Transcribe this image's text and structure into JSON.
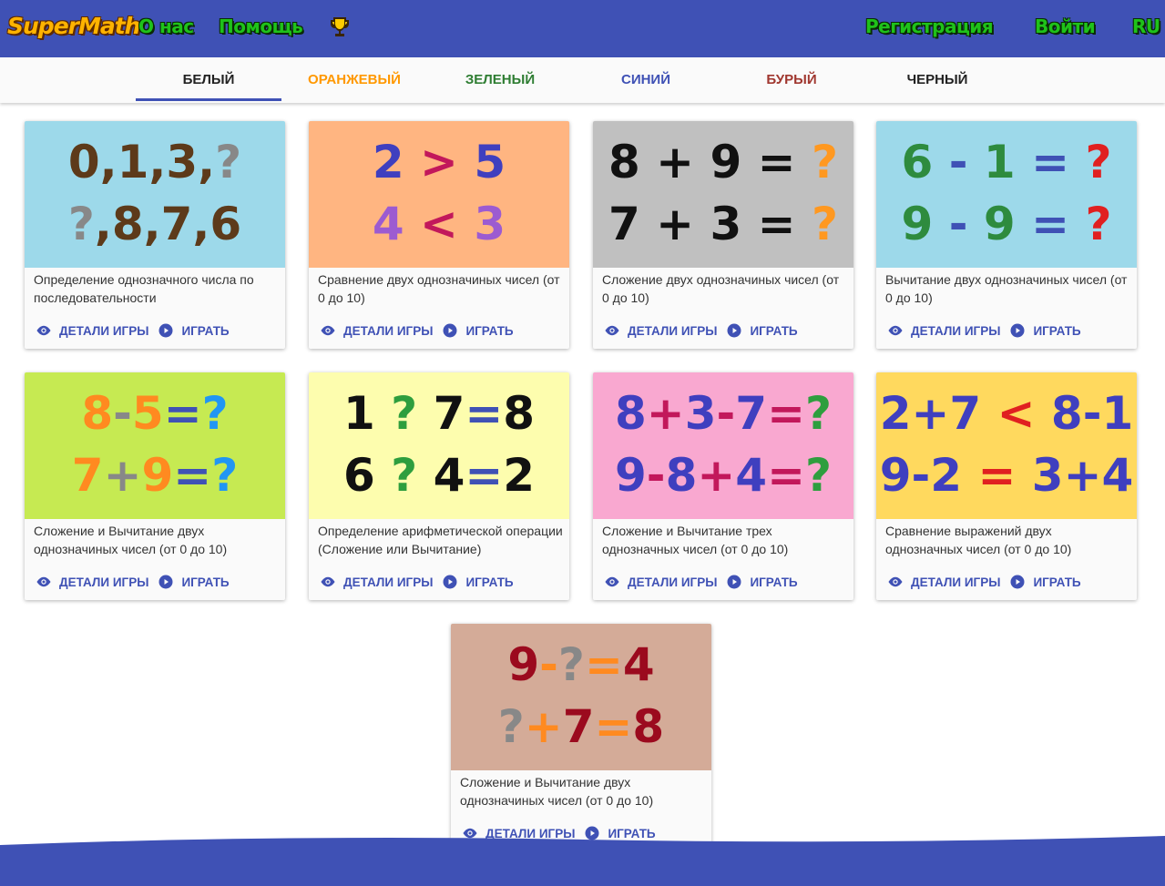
{
  "header": {
    "logo": "SuperMath",
    "about": "О нас",
    "help": "Помощь",
    "register": "Регистрация",
    "login": "Войти",
    "lang": "RU"
  },
  "tabs": [
    {
      "label": "БЕЛЫЙ",
      "color": "#212121",
      "active": true
    },
    {
      "label": "ОРАНЖЕВЫЙ",
      "color": "#ff9800"
    },
    {
      "label": "ЗЕЛЕНЫЙ",
      "color": "#2e7d32"
    },
    {
      "label": "СИНИЙ",
      "color": "#3f51b5"
    },
    {
      "label": "БУРЫЙ",
      "color": "#a0372f"
    },
    {
      "label": "ЧЕРНЫЙ",
      "color": "#212121"
    }
  ],
  "actions": {
    "details": "ДЕТАЛИ ИГРЫ",
    "play": "ИГРАТЬ"
  },
  "cards": [
    {
      "title": "Определение однозначного числа по последовательности",
      "bg": "#9dd9ea",
      "rows": [
        [
          [
            "0,1,3,",
            "#5d3a1a"
          ],
          [
            "?",
            "#888888"
          ]
        ],
        [
          [
            "?",
            "#888888"
          ],
          [
            ",8,7,6",
            "#5d3a1a"
          ]
        ]
      ]
    },
    {
      "title": "Сравнение двух однозначиных чисел (от 0 до 10)",
      "bg": "#ffb581",
      "rows": [
        [
          [
            "2",
            "#3f3fbf"
          ],
          [
            " > ",
            "#c2185b"
          ],
          [
            "5",
            "#3f3fbf"
          ]
        ],
        [
          [
            "4",
            "#9c5bd1"
          ],
          [
            " < ",
            "#c2185b"
          ],
          [
            "3",
            "#9c5bd1"
          ]
        ]
      ]
    },
    {
      "title": "Сложение двух однозначиных чисел (от 0 до 10)",
      "bg": "#c0c0c0",
      "rows": [
        [
          [
            "8 + 9 = ",
            "#111111"
          ],
          [
            "?",
            "#ff9820"
          ]
        ],
        [
          [
            "7 + 3 = ",
            "#111111"
          ],
          [
            "?",
            "#ff9820"
          ]
        ]
      ]
    },
    {
      "title": "Вычитание двух однозначиных чисел (от 0 до 10)",
      "bg": "#9dd9ea",
      "rows": [
        [
          [
            "6",
            "#2e8b3e"
          ],
          [
            " - ",
            "#3f51b5"
          ],
          [
            "1",
            "#2e8b3e"
          ],
          [
            " = ",
            "#3f51b5"
          ],
          [
            "?",
            "#e02020"
          ]
        ],
        [
          [
            "9",
            "#2e8b3e"
          ],
          [
            " - ",
            "#3f51b5"
          ],
          [
            "9",
            "#2e8b3e"
          ],
          [
            " = ",
            "#3f51b5"
          ],
          [
            "?",
            "#e02020"
          ]
        ]
      ]
    },
    {
      "title": "Сложение и Вычитание двух однозначиных чисел (от 0 до 10)",
      "bg": "#c6ea52",
      "rows": [
        [
          [
            "8",
            "#ff8a20"
          ],
          [
            "-",
            "#888888"
          ],
          [
            "5",
            "#ff8a20"
          ],
          [
            "=",
            "#3f51b5"
          ],
          [
            "?",
            "#2196f3"
          ]
        ],
        [
          [
            "7",
            "#ff8a20"
          ],
          [
            "+",
            "#888888"
          ],
          [
            "9",
            "#ff8a20"
          ],
          [
            "=",
            "#3f51b5"
          ],
          [
            "?",
            "#2196f3"
          ]
        ]
      ]
    },
    {
      "title": "Определение арифметической операции (Сложение или Вычитание)",
      "bg": "#fdfdae",
      "rows": [
        [
          [
            "1 ",
            "#111111"
          ],
          [
            "?",
            "#2e9e3e"
          ],
          [
            " 7",
            "#111111"
          ],
          [
            "=",
            "#3f51b5"
          ],
          [
            "8",
            "#111111"
          ]
        ],
        [
          [
            "6 ",
            "#111111"
          ],
          [
            "?",
            "#2e9e3e"
          ],
          [
            " 4",
            "#111111"
          ],
          [
            "=",
            "#3f51b5"
          ],
          [
            "2",
            "#111111"
          ]
        ]
      ]
    },
    {
      "title": "Сложение и Вычитание трех однозначных чисел (от 0 до 10)",
      "bg": "#f9a8d0",
      "rows": [
        [
          [
            "8",
            "#3f3fbf"
          ],
          [
            "+",
            "#c2185b"
          ],
          [
            "3",
            "#3f3fbf"
          ],
          [
            "-",
            "#c2185b"
          ],
          [
            "7",
            "#3f3fbf"
          ],
          [
            "=",
            "#c2185b"
          ],
          [
            "?",
            "#2e9e3e"
          ]
        ],
        [
          [
            "9",
            "#3f3fbf"
          ],
          [
            "-",
            "#c2185b"
          ],
          [
            "8",
            "#3f3fbf"
          ],
          [
            "+",
            "#c2185b"
          ],
          [
            "4",
            "#3f3fbf"
          ],
          [
            "=",
            "#c2185b"
          ],
          [
            "?",
            "#2e9e3e"
          ]
        ]
      ]
    },
    {
      "title": "Сравнение выражений двух однозначных чисел (от 0 до 10)",
      "bg": "#ffd95e",
      "rows": [
        [
          [
            "2+7 ",
            "#3f3fbf"
          ],
          [
            "<",
            "#e02020"
          ],
          [
            " 8-1",
            "#3f3fbf"
          ]
        ],
        [
          [
            "9-2 ",
            "#3f3fbf"
          ],
          [
            "=",
            "#e02020"
          ],
          [
            " 3+4",
            "#3f3fbf"
          ]
        ]
      ]
    },
    {
      "title": "Сложение и Вычитание двух однозначиных чисел (от 0 до 10)",
      "bg": "#d4ab98",
      "rows": [
        [
          [
            "9",
            "#9b0a1e"
          ],
          [
            "-",
            "#ff8a20"
          ],
          [
            "?",
            "#888888"
          ],
          [
            "=",
            "#ff8a20"
          ],
          [
            "4",
            "#9b0a1e"
          ]
        ],
        [
          [
            "?",
            "#888888"
          ],
          [
            "+",
            "#ff8a20"
          ],
          [
            "7",
            "#9b0a1e"
          ],
          [
            "=",
            "#ff8a20"
          ],
          [
            "8",
            "#9b0a1e"
          ]
        ]
      ]
    }
  ],
  "colors": {
    "primary": "#3f51b5",
    "nav_text": "#1fc21a",
    "logo": "#ffb300"
  }
}
